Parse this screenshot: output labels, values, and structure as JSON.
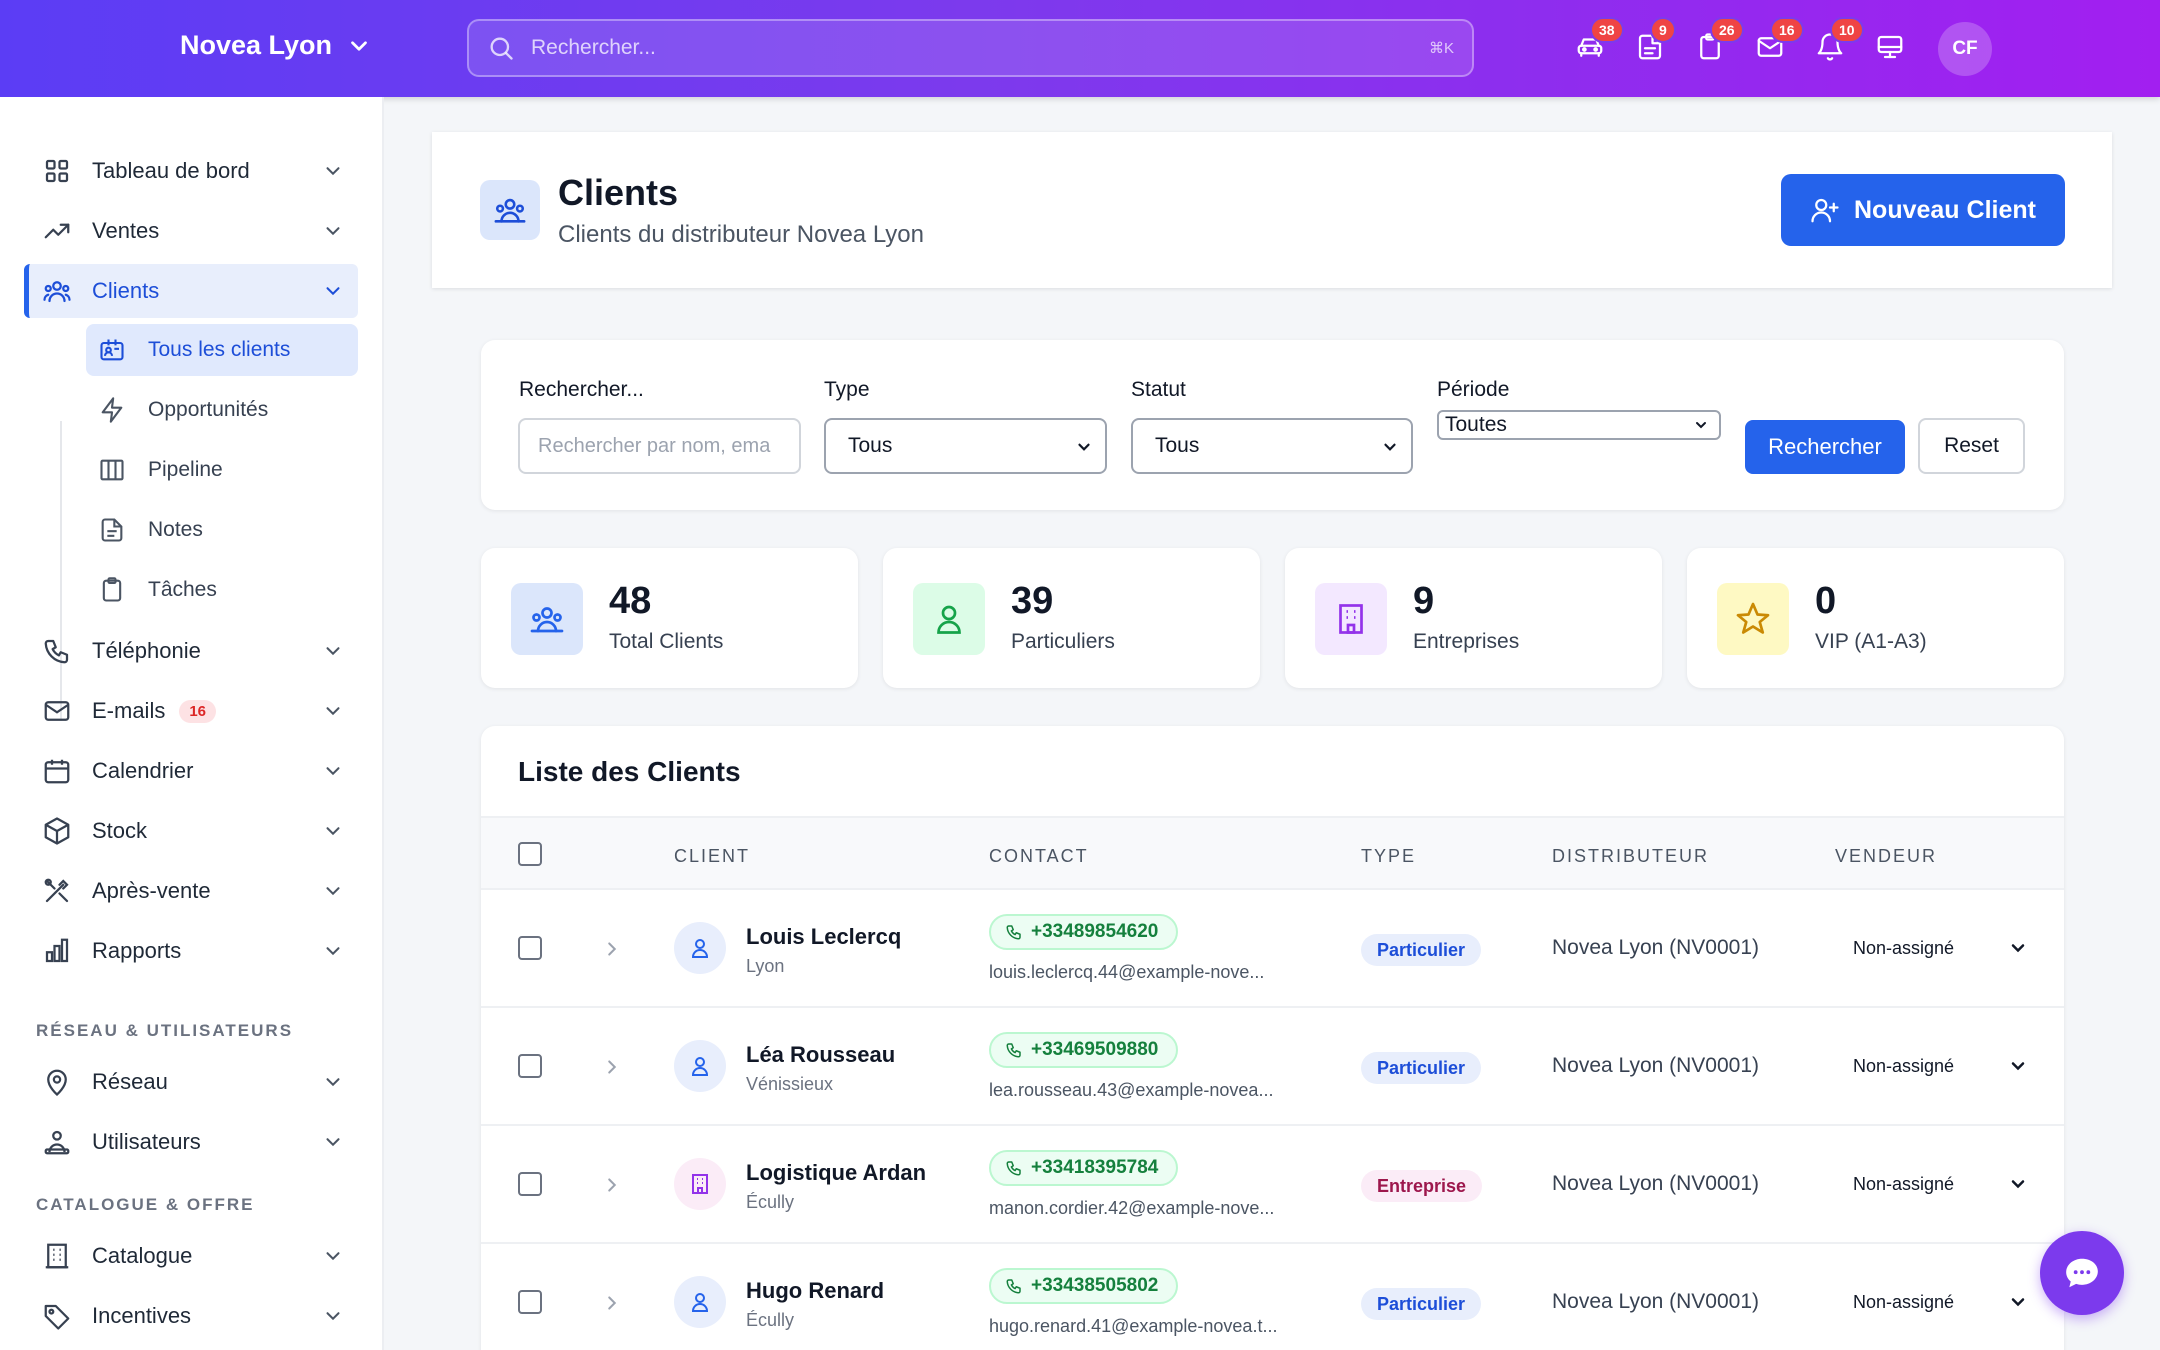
{
  "topbar": {
    "brand": "Novea Lyon",
    "search_placeholder": "Rechercher...",
    "search_shortcut": "⌘K",
    "icons": [
      {
        "name": "car-icon",
        "badge": "38"
      },
      {
        "name": "document-icon",
        "badge": "9"
      },
      {
        "name": "clipboard-icon",
        "badge": "26"
      },
      {
        "name": "mail-icon",
        "badge": "16"
      },
      {
        "name": "bell-icon",
        "badge": "10"
      },
      {
        "name": "monitor-icon",
        "badge": ""
      }
    ],
    "avatar": "CF"
  },
  "sidebar": {
    "items": [
      {
        "label": "Tableau de bord"
      },
      {
        "label": "Ventes"
      },
      {
        "label": "Clients"
      },
      {
        "label": "Téléphonie"
      },
      {
        "label": "E-mails",
        "badge": "16"
      },
      {
        "label": "Calendrier"
      },
      {
        "label": "Stock"
      },
      {
        "label": "Après-vente"
      },
      {
        "label": "Rapports"
      }
    ],
    "sub_items": [
      {
        "label": "Tous les clients"
      },
      {
        "label": "Opportunités"
      },
      {
        "label": "Pipeline"
      },
      {
        "label": "Notes"
      },
      {
        "label": "Tâches"
      }
    ],
    "section_network": "RÉSEAU & UTILISATEURS",
    "network_items": [
      {
        "label": "Réseau"
      },
      {
        "label": "Utilisateurs"
      }
    ],
    "section_catalog": "CATALOGUE & OFFRE",
    "catalog_items": [
      {
        "label": "Catalogue"
      },
      {
        "label": "Incentives"
      }
    ]
  },
  "header": {
    "title": "Clients",
    "subtitle": "Clients du distributeur Novea Lyon",
    "new_button": "Nouveau Client"
  },
  "filters": {
    "search_label": "Rechercher...",
    "search_placeholder": "Rechercher par nom, ema",
    "type_label": "Type",
    "type_value": "Tous",
    "status_label": "Statut",
    "status_value": "Tous",
    "period_label": "Période",
    "period_value": "Toutes",
    "search_button": "Rechercher",
    "reset_button": "Reset"
  },
  "stats": [
    {
      "value": "48",
      "label": "Total Clients",
      "color": "#2563eb"
    },
    {
      "value": "39",
      "label": "Particuliers",
      "color": "#16a34a"
    },
    {
      "value": "9",
      "label": "Entreprises",
      "color": "#9333ea"
    },
    {
      "value": "0",
      "label": "VIP (A1-A3)",
      "color": "#ca8a04"
    }
  ],
  "list": {
    "title": "Liste des Clients",
    "columns": [
      "CLIENT",
      "CONTACT",
      "TYPE",
      "DISTRIBUTEUR",
      "VENDEUR"
    ],
    "rows": [
      {
        "name": "Louis Leclercq",
        "city": "Lyon",
        "phone": "+33489854620",
        "email": "louis.leclercq.44@example-nove...",
        "type": "Particulier",
        "distributor": "Novea Lyon (NV0001)",
        "seller": "Non-assigné"
      },
      {
        "name": "Léa Rousseau",
        "city": "Vénissieux",
        "phone": "+33469509880",
        "email": "lea.rousseau.43@example-novea...",
        "type": "Particulier",
        "distributor": "Novea Lyon (NV0001)",
        "seller": "Non-assigné"
      },
      {
        "name": "Logistique Ardan",
        "city": "Écully",
        "phone": "+33418395784",
        "email": "manon.cordier.42@example-nove...",
        "type": "Entreprise",
        "distributor": "Novea Lyon (NV0001)",
        "seller": "Non-assigné"
      },
      {
        "name": "Hugo Renard",
        "city": "Écully",
        "phone": "+33438505802",
        "email": "hugo.renard.41@example-novea.t...",
        "type": "Particulier",
        "distributor": "Novea Lyon (NV0001)",
        "seller": "Non-assigné"
      }
    ]
  }
}
